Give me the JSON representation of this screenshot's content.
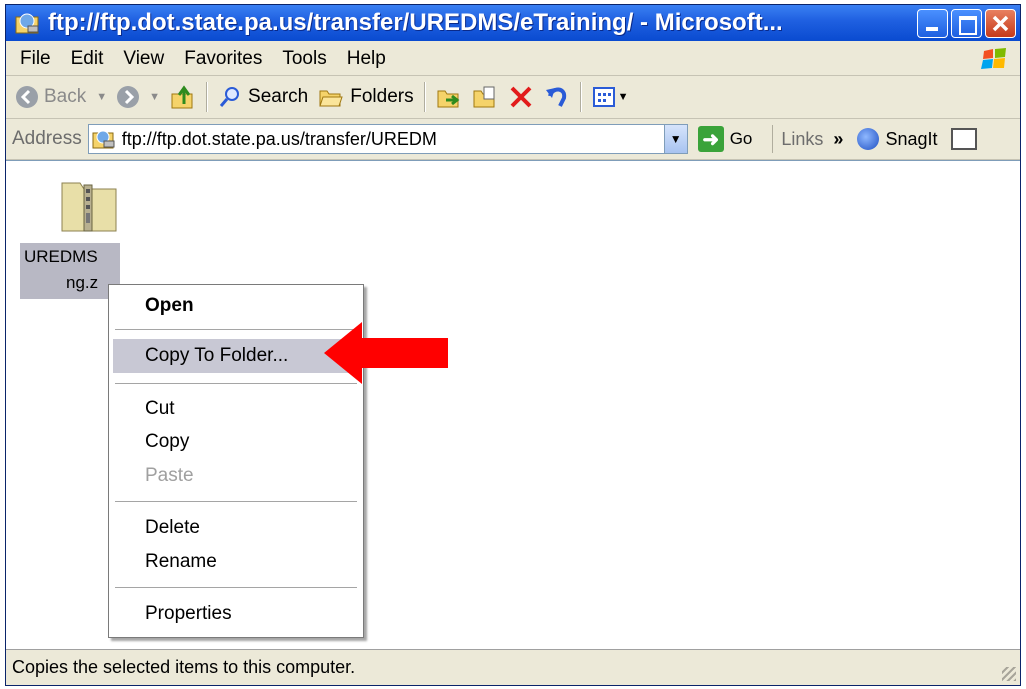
{
  "window": {
    "title": "ftp://ftp.dot.state.pa.us/transfer/UREDMS/eTraining/ - Microsoft..."
  },
  "menubar": {
    "items": [
      "File",
      "Edit",
      "View",
      "Favorites",
      "Tools",
      "Help"
    ]
  },
  "toolbar": {
    "back_label": "Back",
    "search_label": "Search",
    "folders_label": "Folders"
  },
  "addressbar": {
    "label": "Address",
    "value": "ftp://ftp.dot.state.pa.us/transfer/UREDM",
    "go_label": "Go",
    "links_label": "Links",
    "chevron": "»",
    "snagit_label": "SnagIt"
  },
  "file": {
    "name_line1": "UREDMS",
    "name_line2": "ng.z"
  },
  "context_menu": {
    "open": "Open",
    "copy_to_folder": "Copy To Folder...",
    "cut": "Cut",
    "copy": "Copy",
    "paste": "Paste",
    "delete": "Delete",
    "rename": "Rename",
    "properties": "Properties"
  },
  "status": {
    "text": "Copies the selected items to this computer."
  },
  "colors": {
    "titlebar": "#1e5fe0",
    "highlight": "#c8c8d4",
    "arrow": "#ff0000"
  }
}
